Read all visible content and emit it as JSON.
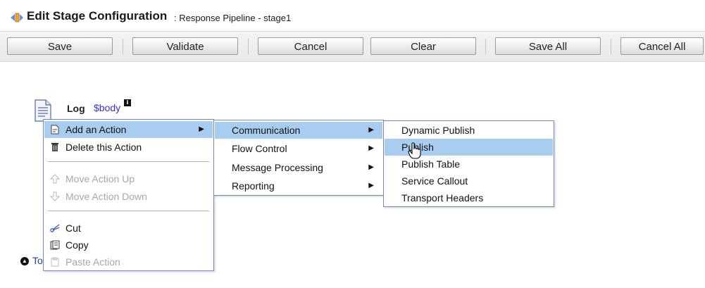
{
  "header": {
    "title": "Edit Stage Configuration",
    "subtitle": ": Response Pipeline - stage1"
  },
  "toolbar": {
    "save": "Save",
    "validate": "Validate",
    "cancel": "Cancel",
    "clear": "Clear",
    "save_all": "Save All",
    "cancel_all": "Cancel All"
  },
  "stage": {
    "action_label": "Log",
    "expression": "$body",
    "info_glyph": "i",
    "bottom_link_text": "To"
  },
  "context_menu": {
    "items": [
      {
        "label": "Add an Action",
        "icon": "add-action-icon",
        "arrow": "▶"
      },
      {
        "label": "Delete this Action",
        "icon": "trash-icon"
      },
      {
        "label": "Move Action Up",
        "icon": "arrow-up-icon"
      },
      {
        "label": "Move Action Down",
        "icon": "arrow-down-icon"
      },
      {
        "label": "Cut",
        "icon": "scissors-icon"
      },
      {
        "label": "Copy",
        "icon": "copy-icon"
      },
      {
        "label": "Paste Action",
        "icon": "paste-icon"
      }
    ]
  },
  "action_submenu": {
    "items": [
      {
        "label": "Communication",
        "arrow": "▶"
      },
      {
        "label": "Flow Control",
        "arrow": "▶"
      },
      {
        "label": "Message Processing",
        "arrow": "▶"
      },
      {
        "label": "Reporting",
        "arrow": "▶"
      }
    ]
  },
  "communication_submenu": {
    "items": [
      {
        "label": "Dynamic Publish"
      },
      {
        "label": "Publish"
      },
      {
        "label": "Publish Table"
      },
      {
        "label": "Service Callout"
      },
      {
        "label": "Transport Headers"
      }
    ]
  },
  "colors": {
    "highlight": "#a9cdf1",
    "menu_border": "#7386c8",
    "link": "#3333cc",
    "disabled_text": "#a8a8a8"
  }
}
